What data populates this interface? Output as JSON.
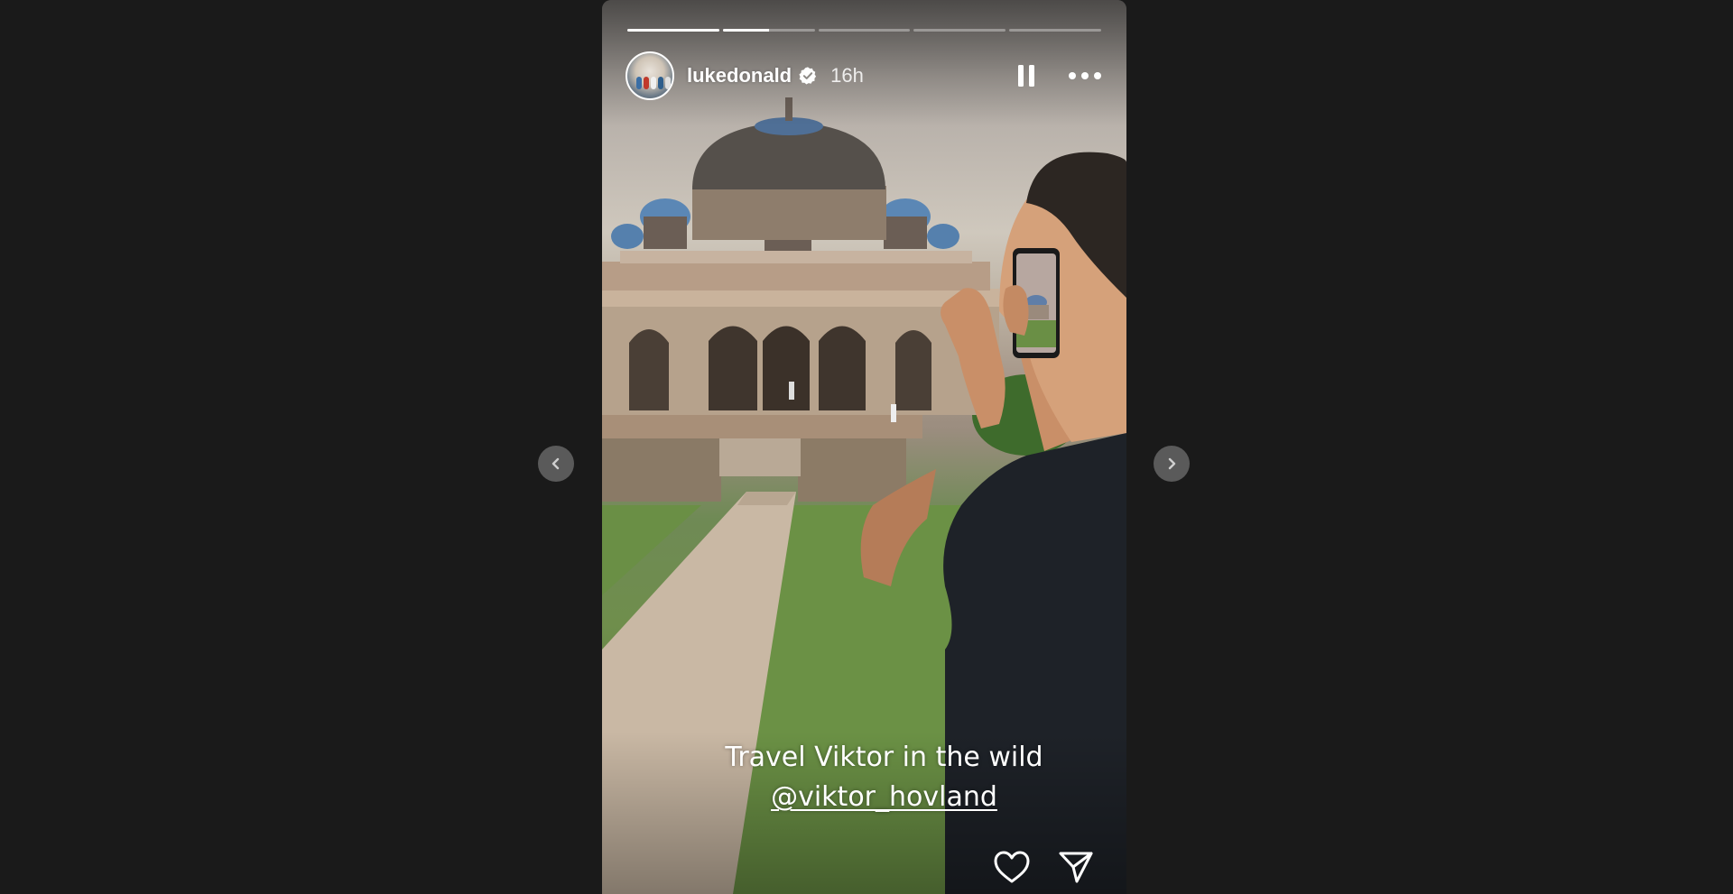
{
  "story": {
    "progress_segments": [
      1.0,
      0.5,
      0,
      0,
      0
    ],
    "username": "lukedonald",
    "verified_icon": "verified-badge-icon",
    "time_ago": "16h",
    "pause_icon": "pause-icon",
    "more_icon": "more-options-icon",
    "caption_line1": "Travel Viktor in the wild",
    "caption_mention": "@viktor_hovland",
    "like_icon": "heart-icon",
    "share_icon": "send-icon"
  },
  "navigation": {
    "prev_icon": "chevron-left-icon",
    "next_icon": "chevron-right-icon"
  },
  "colors": {
    "background": "#1a1a1a",
    "nav_button": "#5a5a5a",
    "verified_blue": "#ffffff"
  }
}
